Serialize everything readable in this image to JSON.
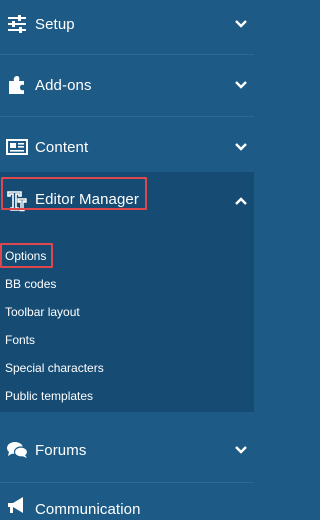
{
  "sidebar": {
    "sections": {
      "setup": {
        "label": "Setup",
        "icon": "sliders-icon",
        "state": "collapsed"
      },
      "addons": {
        "label": "Add-ons",
        "icon": "puzzle-icon",
        "state": "collapsed"
      },
      "content": {
        "label": "Content",
        "icon": "newspaper-icon",
        "state": "collapsed"
      },
      "editor": {
        "label": "Editor Manager",
        "icon": "text-format-icon",
        "state": "expanded"
      },
      "forums": {
        "label": "Forums",
        "icon": "chat-bubbles-icon",
        "state": "collapsed"
      },
      "communication": {
        "label": "Communication",
        "icon": "megaphone-icon",
        "state": "collapsed"
      }
    },
    "editor_items": [
      {
        "label": "Options"
      },
      {
        "label": "BB codes"
      },
      {
        "label": "Toolbar layout"
      },
      {
        "label": "Fonts"
      },
      {
        "label": "Special characters"
      },
      {
        "label": "Public templates"
      }
    ]
  },
  "colors": {
    "background": "#1d5a86",
    "active_background": "#164b73",
    "highlight_border": "#e0474c",
    "text": "#ffffff"
  }
}
